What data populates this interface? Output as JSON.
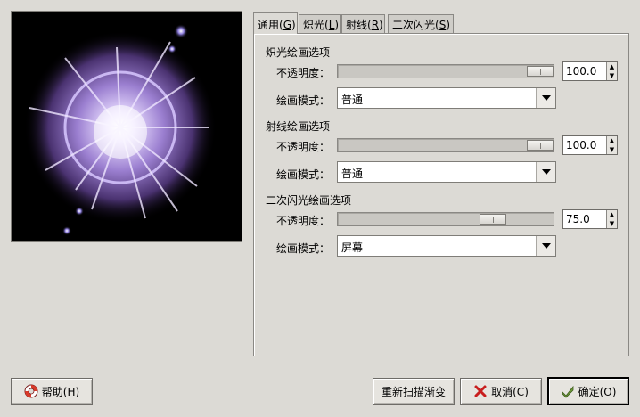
{
  "tabs": [
    {
      "label": "通用(",
      "mn": "G",
      "end": ")"
    },
    {
      "label": "炽光(",
      "mn": "L",
      "end": ")"
    },
    {
      "label": "射线(",
      "mn": "R",
      "end": ")"
    },
    {
      "label": "二次闪光(",
      "mn": "S",
      "end": ")"
    }
  ],
  "sections": [
    {
      "title": "炽光绘画选项",
      "opacity_label": "不透明度：",
      "opacity": "100.0",
      "opacity_fraction": 1.0,
      "mode_label": "绘画模式：",
      "mode": "普通"
    },
    {
      "title": "射线绘画选项",
      "opacity_label": "不透明度：",
      "opacity": "100.0",
      "opacity_fraction": 1.0,
      "mode_label": "绘画模式：",
      "mode": "普通"
    },
    {
      "title": "二次闪光绘画选项",
      "opacity_label": "不透明度：",
      "opacity": "75.0",
      "opacity_fraction": 0.75,
      "mode_label": "绘画模式：",
      "mode": "屏幕"
    }
  ],
  "buttons": {
    "help": {
      "label": "帮助(",
      "mn": "H",
      "end": ")"
    },
    "rescan": {
      "label": "重新扫描渐变"
    },
    "cancel": {
      "label": "取消(",
      "mn": "C",
      "end": ")"
    },
    "ok": {
      "label": "确定(",
      "mn": "O",
      "end": ")"
    }
  },
  "icons": {
    "help": "lifebuoy-icon",
    "cancel": "red-x-icon",
    "ok": "check-arrow-icon"
  }
}
